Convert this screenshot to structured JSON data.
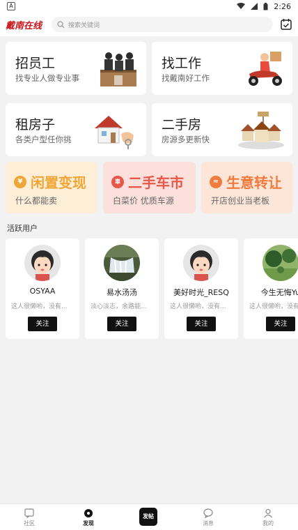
{
  "status_bar": {
    "time": "2:26"
  },
  "header": {
    "logo_text": "戴南在线",
    "search_placeholder": "搜索关键词"
  },
  "services": [
    {
      "title": "招员工",
      "subtitle": "找专业人做专业事"
    },
    {
      "title": "找工作",
      "subtitle": "找戴南好工作"
    },
    {
      "title": "租房子",
      "subtitle": "各类户型任你挑"
    },
    {
      "title": "二手房",
      "subtitle": "房源多更新快"
    }
  ],
  "promos": [
    {
      "badge": "¥",
      "title": "闲置变现",
      "subtitle": "什么都能卖",
      "color": "#f0a637",
      "bg": "#fdeed8"
    },
    {
      "badge": "車",
      "title": "二手车市",
      "subtitle": "白菜价 优质车源",
      "color": "#e5584a",
      "bg": "#fbe0dc"
    },
    {
      "badge": "≈",
      "title": "生意转让",
      "subtitle": "开店创业当老板",
      "color": "#ef7b3f",
      "bg": "#fde6d8"
    }
  ],
  "active_users": {
    "title": "活跃用户",
    "users": [
      {
        "name": "OSYAA",
        "bio": "这人很懒哟，没有...",
        "follow": "关注",
        "avatar": "default-avatar"
      },
      {
        "name": "易水汤汤",
        "bio": "淡心淡志，余路能...",
        "follow": "关注",
        "avatar": "waterfall-photo"
      },
      {
        "name": "美好时光_RESQ",
        "bio": "这人很懒哟，没有...",
        "follow": "关注",
        "avatar": "default-avatar"
      },
      {
        "name": "今生无悔Yu",
        "bio": "这人很懒哟，没有...",
        "follow": "关注",
        "avatar": "garden-photo"
      }
    ]
  },
  "tabbar": {
    "items": [
      {
        "label": "社区"
      },
      {
        "label": "发现"
      },
      {
        "label": "发帖"
      },
      {
        "label": "消息"
      },
      {
        "label": "我的"
      }
    ]
  }
}
